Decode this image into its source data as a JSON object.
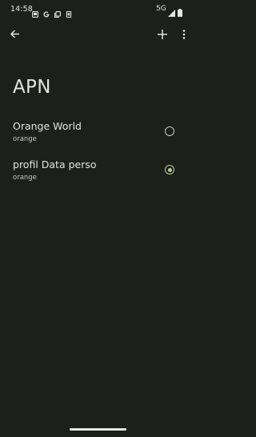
{
  "status_bar": {
    "time": "14:58",
    "network": "5G",
    "icons": [
      "screen-icon",
      "google-icon",
      "copy-icon",
      "sim-icon",
      "signal-icon",
      "battery-icon"
    ]
  },
  "toolbar": {
    "back_icon": "arrow-back-icon",
    "add_icon": "add-icon",
    "more_icon": "more-vert-icon"
  },
  "page": {
    "title": "APN"
  },
  "apns": [
    {
      "name": "Orange World",
      "subtitle": "orange",
      "selected": false
    },
    {
      "name": "profil Data perso",
      "subtitle": "orange",
      "selected": true
    }
  ],
  "colors": {
    "background": "#1d1f1b",
    "accent": "#b6d09a",
    "text": "#e3e4dc",
    "secondary_text": "#c3c8bb"
  }
}
